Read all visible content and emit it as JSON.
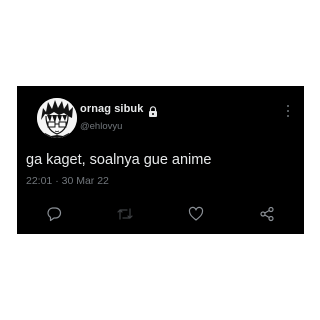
{
  "user": {
    "display_name": "ornag sibuk",
    "handle": "@ehlovyu",
    "avatar_icon": "anime-boy-avatar",
    "protected_icon": "lock-icon"
  },
  "tweet": {
    "text": "ga kaget, soalnya gue anime",
    "time": "22:01",
    "separator": "·",
    "date": "30 Mar 22",
    "meta": "22:01 · 30 Mar 22"
  },
  "actions": [
    {
      "icon": "reply-icon"
    },
    {
      "icon": "retweet-icon",
      "disabled": true
    },
    {
      "icon": "like-icon"
    },
    {
      "icon": "share-icon"
    }
  ],
  "colors": {
    "background": "#000000",
    "text_primary": "#e7e9ea",
    "text_secondary": "#71767b",
    "disabled": "#3e4144"
  }
}
